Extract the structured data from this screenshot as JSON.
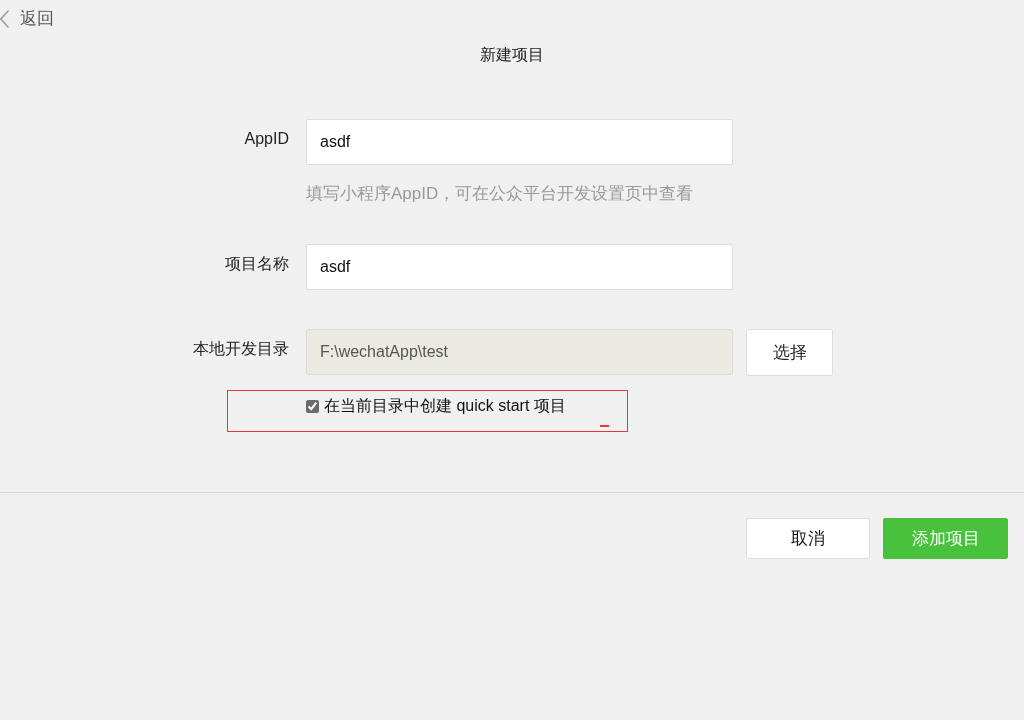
{
  "header": {
    "back_label": "返回",
    "title": "新建项目"
  },
  "form": {
    "fields": [
      {
        "label": "AppID",
        "value": "asdf",
        "hint": "填写小程序AppID，可在公众平台开发设置页中查看",
        "disabled": false
      },
      {
        "label": "项目名称",
        "value": "asdf",
        "disabled": false
      },
      {
        "label": "本地开发目录",
        "value": "F:\\wechatApp\\test",
        "disabled": true,
        "button": "选择"
      }
    ],
    "quick_start": {
      "label": "在当前目录中创建 quick start 项目",
      "checked": true,
      "highlighted": true
    }
  },
  "footer": {
    "buttons": [
      {
        "label": "取消",
        "kind": "secondary"
      },
      {
        "label": "添加项目",
        "kind": "primary"
      }
    ]
  }
}
